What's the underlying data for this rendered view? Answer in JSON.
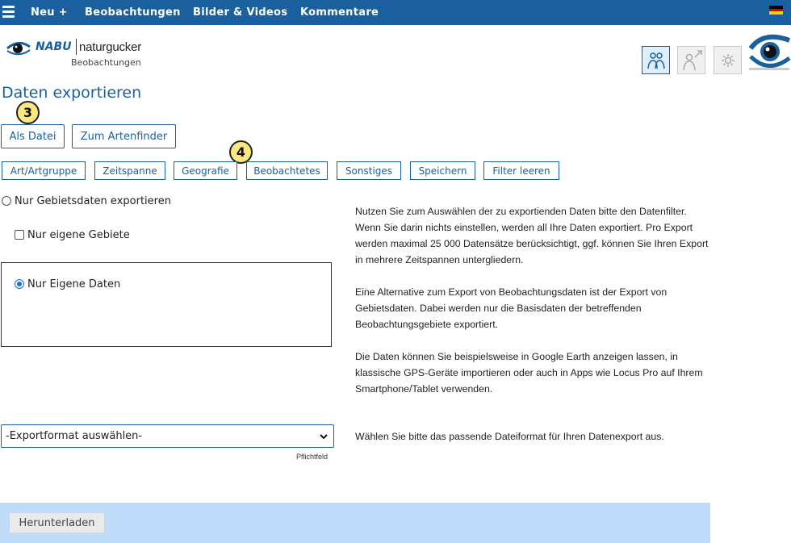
{
  "nav": {
    "items": [
      {
        "label": "Neu +"
      },
      {
        "label": "Beobachtungen"
      },
      {
        "label": "Bilder & Videos"
      },
      {
        "label": "Kommentare"
      }
    ],
    "flag_colors": [
      "#000000",
      "#dd0000",
      "#ffce00"
    ]
  },
  "header": {
    "logo_brand": "NABU",
    "logo_name": "naturgucker",
    "logo_sub": "Beobachtungen",
    "icons": [
      "people-icon",
      "person-share-icon",
      "gear-icon",
      "naturgucker-eye-logo"
    ]
  },
  "page": {
    "title": "Daten exportieren"
  },
  "steps": {
    "step3": "3",
    "step4": "4"
  },
  "main_buttons": {
    "als_datei": "Als Datei",
    "zum_artenfinder": "Zum Artenfinder"
  },
  "filter_tabs": [
    {
      "label": "Art/Artgruppe"
    },
    {
      "label": "Zeitspanne"
    },
    {
      "label": "Geografie"
    },
    {
      "label": "Beobachtetes"
    },
    {
      "label": "Sonstiges"
    },
    {
      "label": "Speichern"
    },
    {
      "label": "Filter leeren"
    }
  ],
  "options": {
    "nur_gebietsdaten": {
      "label": "Nur Gebietsdaten exportieren",
      "checked": false
    },
    "nur_eigene_gebiete": {
      "label": "Nur eigene Gebiete",
      "checked": false
    },
    "nur_eigene_daten": {
      "label": "Nur Eigene Daten",
      "checked": true
    }
  },
  "info": {
    "p1": "Nutzen Sie zum Auswählen der zu exportienden Daten bitte den Datenfilter. Wenn Sie darin nichts einstellen, werden all Ihre Daten exportiert. Pro Export werden maximal 25 000 Datensätze berücksichtigt, ggf. können Sie Ihren Export in mehrere Zeitspannen untergliedern.",
    "p2": "Eine Alternative zum Export von Beobachtungsdaten ist der Export von Gebietsdaten. Dabei werden nur die Basisdaten der betreffenden Beobachtungsgebiete exportiert.",
    "p3": "Die Daten können Sie beispielsweise in Google Earth anzeigen lassen, in klassische GPS-Geräte importieren oder auch in Apps wie Locus Pro auf Ihrem Smartphone/Tablet verwenden."
  },
  "export_format": {
    "selected": "-Exportformat auswählen-",
    "required_note": "Pflichtfeld",
    "hint": "Wählen Sie bitte das passende Dateiformat für Ihren Datenexport aus."
  },
  "download": {
    "label": "Herunterladen"
  },
  "colors": {
    "nav_bg": "#1a5f9e",
    "accent": "#1a5f9e",
    "badge": "#fce880",
    "bottom_bar": "#bedcfa"
  }
}
